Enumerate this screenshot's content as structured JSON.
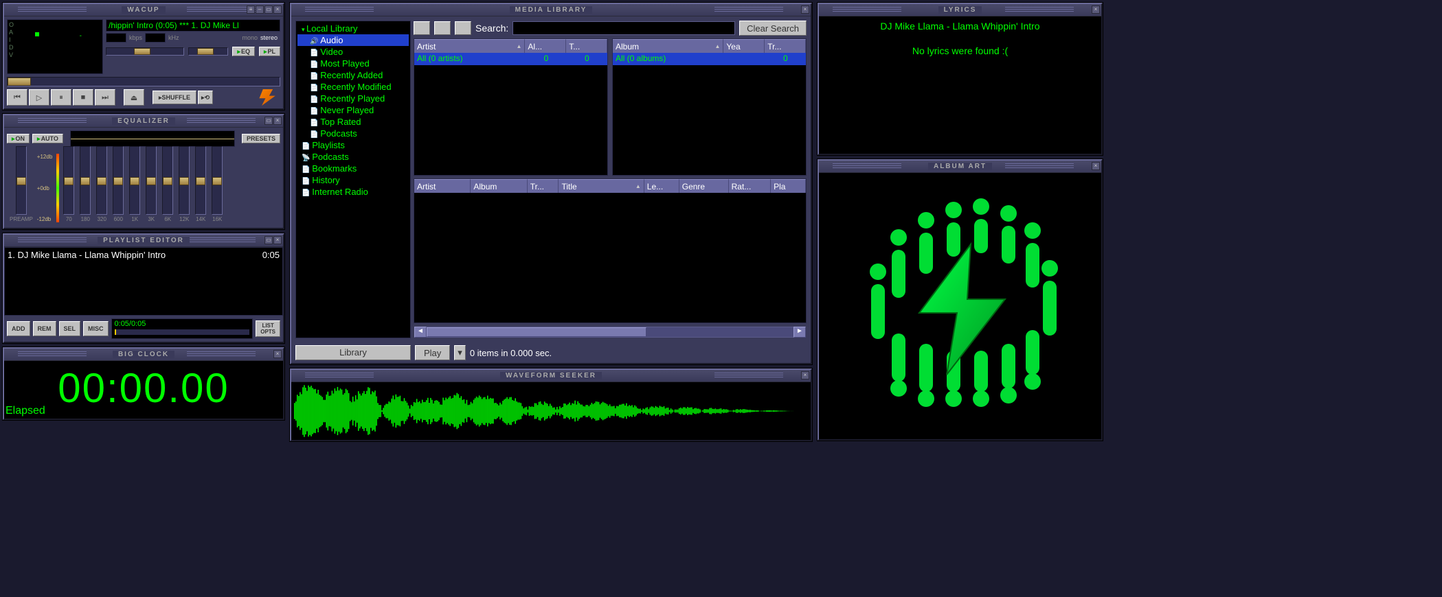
{
  "player": {
    "title": "WACUP",
    "marquee": "/hippin' Intro (0:05)  ***  1. DJ Mike Ll",
    "kbps_label": "kbps",
    "khz_label": "kHz",
    "mono": "mono",
    "stereo": "stereo",
    "eq_btn": "EQ",
    "pl_btn": "PL",
    "shuffle": "SHUFFLE",
    "vis_letters": "O\nA\nI\nD\nV"
  },
  "equalizer": {
    "title": "EQUALIZER",
    "on": "ON",
    "auto": "AUTO",
    "presets": "PRESETS",
    "preamp": "PREAMP",
    "db_plus": "+12db",
    "db_zero": "+0db",
    "db_minus": "-12db",
    "bands": [
      "70",
      "180",
      "320",
      "600",
      "1K",
      "3K",
      "6K",
      "12K",
      "14K",
      "16K"
    ]
  },
  "playlist": {
    "title": "PLAYLIST EDITOR",
    "items": [
      {
        "label": "1. DJ Mike Llama - Llama Whippin' Intro",
        "time": "0:05"
      }
    ],
    "add": "ADD",
    "rem": "REM",
    "sel": "SEL",
    "misc": "MISC",
    "listopts": "LIST\nOPTS",
    "status": "0:05/0:05"
  },
  "bigclock": {
    "title": "BIG CLOCK",
    "time": "00:00.00",
    "label": "Elapsed"
  },
  "library": {
    "title": "MEDIA LIBRARY",
    "search_label": "Search:",
    "clear": "Clear Search",
    "tree": {
      "local": "Local Library",
      "audio": "Audio",
      "video": "Video",
      "most_played": "Most Played",
      "recently_added": "Recently Added",
      "recently_modified": "Recently Modified",
      "recently_played": "Recently Played",
      "never_played": "Never Played",
      "top_rated": "Top Rated",
      "podcasts_sub": "Podcasts",
      "playlists": "Playlists",
      "podcasts": "Podcasts",
      "bookmarks": "Bookmarks",
      "history": "History",
      "radio": "Internet Radio"
    },
    "artist_cols": {
      "artist": "Artist",
      "al": "Al...",
      "tr": "T..."
    },
    "artist_row": {
      "all": "All (0 artists)",
      "al": "0",
      "tr": "0"
    },
    "album_cols": {
      "album": "Album",
      "year": "Yea",
      "tr": "Tr..."
    },
    "album_row": {
      "all": "All (0 albums)",
      "year": "",
      "tr": "0"
    },
    "track_cols": [
      "Artist",
      "Album",
      "Tr...",
      "Title",
      "Le...",
      "Genre",
      "Rat...",
      "Pla"
    ],
    "library_btn": "Library",
    "play_btn": "Play",
    "status": "0 items in 0.000 sec."
  },
  "waveform": {
    "title": "WAVEFORM SEEKER"
  },
  "lyrics": {
    "title": "LYRICS",
    "song": "DJ Mike Llama - Llama Whippin' Intro",
    "none": "No lyrics were found :("
  },
  "albumart": {
    "title": "ALBUM ART"
  }
}
